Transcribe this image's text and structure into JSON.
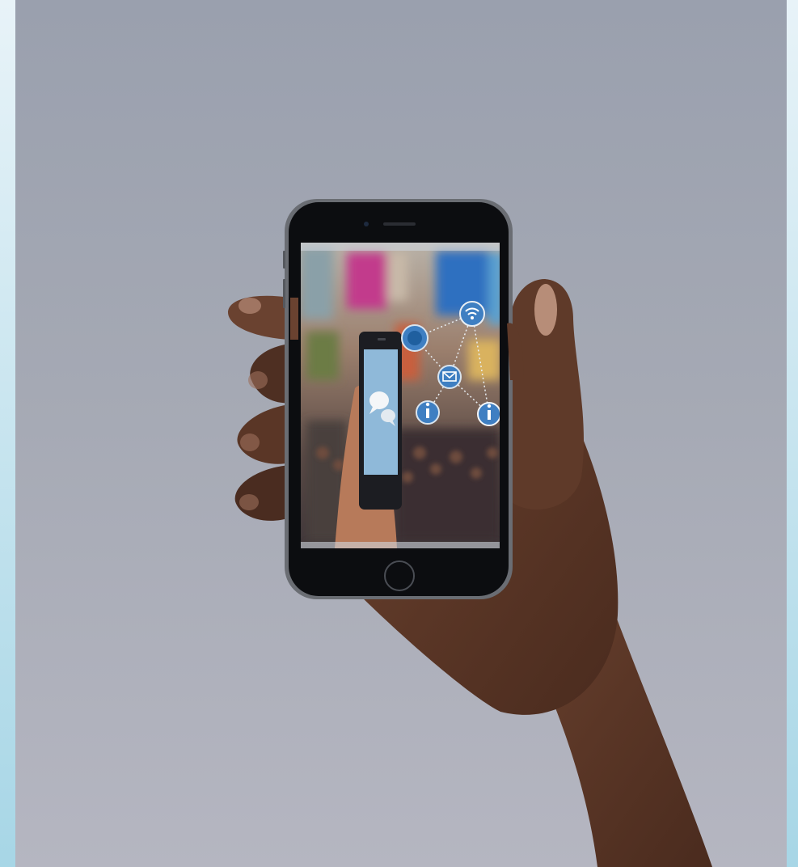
{
  "scene": {
    "frame_color": "#a7d6e6",
    "backdrop_color": "#a2a7b3",
    "skin_color": "#5e3a2a",
    "phone_color": "#0c0d10",
    "inner_phone_screen_color": "#8fb9d9",
    "network_icon_color": "#3f7fc2",
    "icons": [
      "wifi-icon",
      "mail-icon",
      "info-icon",
      "info-icon",
      "globe-icon",
      "chat-bubbles-icon"
    ]
  }
}
